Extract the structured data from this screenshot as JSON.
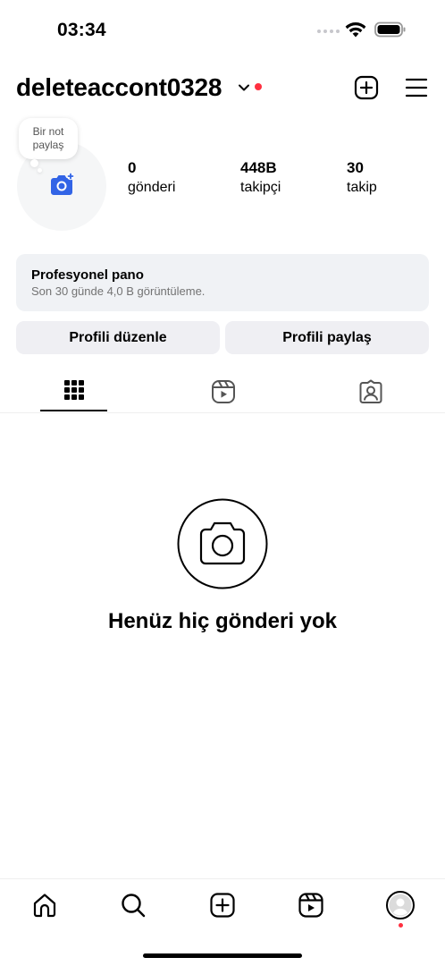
{
  "status_bar": {
    "time": "03:34",
    "icons": [
      "cellular-signal-icon",
      "wifi-icon",
      "battery-icon"
    ]
  },
  "header": {
    "username": "deleteaccont0328",
    "notification_color": "#ff3040",
    "icons": [
      "chevron-down-icon",
      "create-plus-icon",
      "menu-icon"
    ]
  },
  "profile": {
    "note_line1": "Bir not",
    "note_line2": "paylaş",
    "avatar_icon": "add-photo-camera-icon",
    "accent_color": "#3264e6",
    "stats": {
      "posts": {
        "value": "0",
        "label": "gönderi"
      },
      "followers": {
        "value": "448B",
        "label": "takipçi"
      },
      "following": {
        "value": "30",
        "label": "takip"
      }
    }
  },
  "dashboard": {
    "title": "Profesyonel pano",
    "subtitle": "Son 30 günde 4,0 B görüntüleme."
  },
  "actions": {
    "edit_profile": "Profili düzenle",
    "share_profile": "Profili paylaş"
  },
  "tabs": [
    {
      "icon": "grid-icon",
      "selected": true
    },
    {
      "icon": "reels-icon",
      "selected": false
    },
    {
      "icon": "tagged-icon",
      "selected": false
    }
  ],
  "empty_state": {
    "icon": "camera-icon",
    "text": "Henüz hiç gönderi yok"
  },
  "bottom_nav": [
    "home-icon",
    "search-icon",
    "create-icon",
    "reels-icon",
    "profile-avatar-icon"
  ]
}
